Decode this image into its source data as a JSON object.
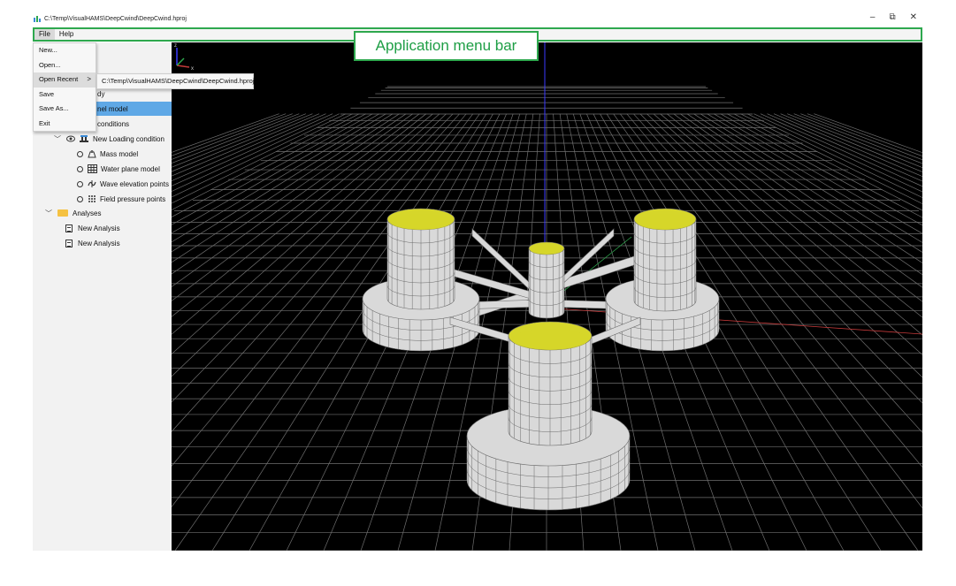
{
  "window": {
    "title": "C:\\Temp\\VisualHAMS\\DeepCwind\\DeepCwind.hproj",
    "controls": {
      "minimize": "–",
      "restore": "⧉",
      "close": "✕"
    }
  },
  "menubar": {
    "items": [
      {
        "label": "File"
      },
      {
        "label": "Help"
      }
    ],
    "annotation": "Application menu bar"
  },
  "file_menu": {
    "items": [
      {
        "label": "New..."
      },
      {
        "label": "Open..."
      },
      {
        "label": "Open Recent",
        "arrow": ">"
      },
      {
        "label": "Save"
      },
      {
        "label": "Save As..."
      },
      {
        "label": "Exit"
      }
    ],
    "recent": [
      "C:\\Temp\\VisualHAMS\\DeepCwind\\DeepCwind.hproj"
    ]
  },
  "tree": {
    "partial_body": "dy",
    "partial_panel": "nel model",
    "partial_conditions": "conditions",
    "loading_condition": "New Loading condition",
    "mass_model": "Mass model",
    "water_plane_model": "Water plane model",
    "wave_elevation_points": "Wave elevation points",
    "field_pressure_points": "Field pressure points",
    "analyses": "Analyses",
    "analysis_items": [
      "New Analysis",
      "New Analysis"
    ]
  },
  "viewport": {
    "axes": {
      "x": "x",
      "z": "z"
    },
    "colors": {
      "background": "#000000",
      "grid": "#6f6f6f",
      "hull": "#d9d9d9",
      "hull_lines": "#6a6a6a",
      "inner_top": "#d6d62a",
      "vertical_axis": "#3a3aff",
      "x_axis": "#c43a3a",
      "y_axis": "#2ea84e"
    }
  },
  "colors": {
    "accent_green": "#2ea84e",
    "selection_blue": "#5fa8e6"
  }
}
